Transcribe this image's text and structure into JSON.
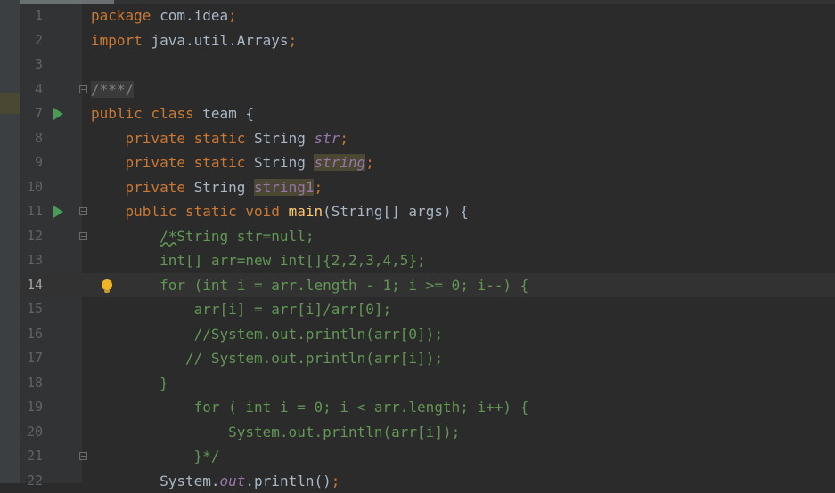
{
  "editor": {
    "active_line": "14",
    "lines": [
      {
        "num": "1",
        "parts": [
          [
            "kw",
            "package "
          ],
          [
            "txt",
            "com.idea"
          ],
          [
            "kw",
            ";"
          ]
        ]
      },
      {
        "num": "2",
        "parts": [
          [
            "kw",
            "import "
          ],
          [
            "txt",
            "java.util.Arrays"
          ],
          [
            "kw",
            ";"
          ]
        ]
      },
      {
        "num": "3",
        "parts": []
      },
      {
        "num": "4",
        "parts": [
          [
            "grey",
            "/***/"
          ]
        ]
      },
      {
        "num": "7",
        "parts": [
          [
            "kw",
            "public class "
          ],
          [
            "txt",
            "team {"
          ]
        ]
      },
      {
        "num": "8",
        "parts": [
          [
            "txt",
            "    "
          ],
          [
            "kw",
            "private static "
          ],
          [
            "txt",
            "String "
          ],
          [
            "field",
            "str"
          ],
          [
            "kw",
            ";"
          ]
        ]
      },
      {
        "num": "9",
        "parts": [
          [
            "txt",
            "    "
          ],
          [
            "kw",
            "private static "
          ],
          [
            "txt",
            "String "
          ],
          [
            "fieldhl",
            "string"
          ],
          [
            "kw",
            ";"
          ]
        ]
      },
      {
        "num": "10",
        "parts": [
          [
            "txt",
            "    "
          ],
          [
            "kw",
            "private "
          ],
          [
            "txt",
            "String "
          ],
          [
            "fieldhl2",
            "string1"
          ],
          [
            "kw",
            ";"
          ]
        ]
      },
      {
        "num": "11",
        "parts": [
          [
            "txt",
            "    "
          ],
          [
            "kw",
            "public static void "
          ],
          [
            "fn",
            "main"
          ],
          [
            "txt",
            "(String[] args) {"
          ]
        ]
      },
      {
        "num": "12",
        "parts": [
          [
            "txt",
            "        "
          ],
          [
            "cmw",
            "/*"
          ],
          [
            "cm",
            "String str=null;"
          ]
        ]
      },
      {
        "num": "13",
        "parts": [
          [
            "txt",
            "        "
          ],
          [
            "cm",
            "int[] arr=new int[]{2,2,3,4,5};"
          ]
        ]
      },
      {
        "num": "14",
        "parts": [
          [
            "txt",
            "        "
          ],
          [
            "cm",
            "for (int i = arr.length - 1; i >= 0; i--) {"
          ]
        ]
      },
      {
        "num": "15",
        "parts": [
          [
            "txt",
            "            "
          ],
          [
            "cm",
            "arr[i] = arr[i]/arr[0];"
          ]
        ]
      },
      {
        "num": "16",
        "parts": [
          [
            "txt",
            "            "
          ],
          [
            "cm",
            "//System.out.println(arr[0]);"
          ]
        ]
      },
      {
        "num": "17",
        "parts": [
          [
            "txt",
            "           "
          ],
          [
            "cm",
            "// System.out.println(arr[i]);"
          ]
        ]
      },
      {
        "num": "18",
        "parts": [
          [
            "txt",
            "        "
          ],
          [
            "cm",
            "}"
          ]
        ]
      },
      {
        "num": "19",
        "parts": [
          [
            "txt",
            "            "
          ],
          [
            "cm",
            "for ( int i = 0; i < arr.length; i++) {"
          ]
        ]
      },
      {
        "num": "20",
        "parts": [
          [
            "txt",
            "                "
          ],
          [
            "cm",
            "System.out.println(arr[i]);"
          ]
        ]
      },
      {
        "num": "21",
        "parts": [
          [
            "txt",
            "            "
          ],
          [
            "cm",
            "}*/"
          ]
        ]
      },
      {
        "num": "22",
        "parts": [
          [
            "txt",
            "        System."
          ],
          [
            "field",
            "out"
          ],
          [
            "txt",
            ".println()"
          ],
          [
            "kw",
            ";"
          ]
        ]
      }
    ]
  },
  "gutter_icons": {
    "run_lines": [
      "7",
      "11"
    ],
    "fold_lines": [
      "4",
      "11",
      "12",
      "21"
    ],
    "bulb_line": "14"
  },
  "colors": {
    "background": "#2b2b2b",
    "keyword": "#cc7832",
    "comment": "#629755",
    "method": "#ffc66d",
    "field": "#9876aa",
    "run": "#499c54",
    "bulb": "#f0b429"
  }
}
